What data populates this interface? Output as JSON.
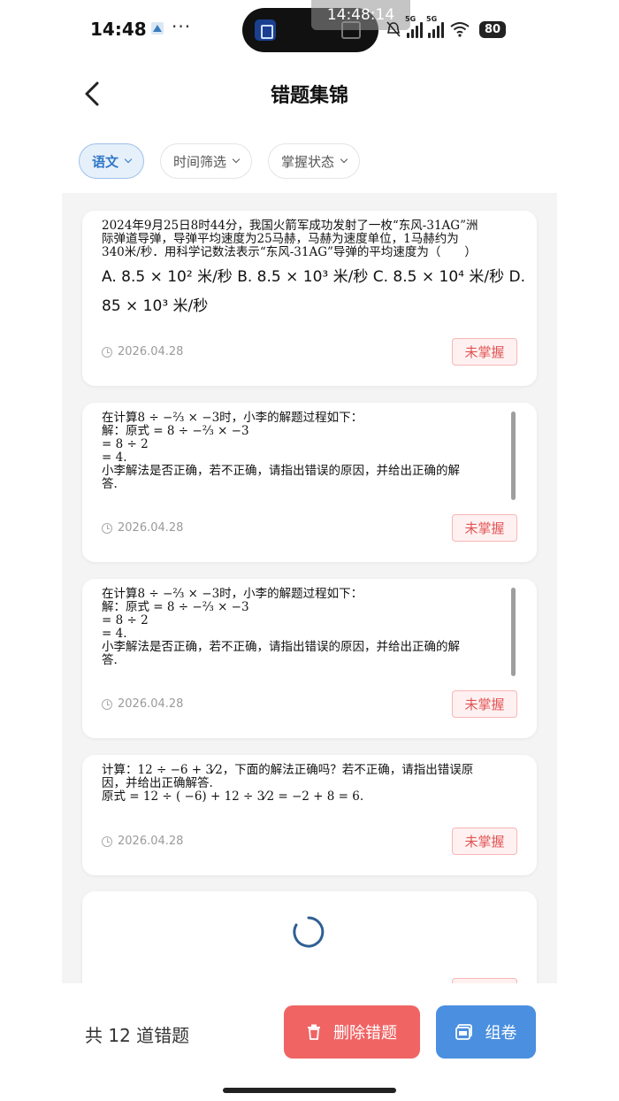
{
  "status_bar": {
    "time": "14:48",
    "dots": "···",
    "overlay_time": "14:48:14",
    "network_a": "5G",
    "network_b": "5G",
    "battery": "80"
  },
  "header": {
    "title": "错题集锦"
  },
  "filters": [
    {
      "label": "语文",
      "active": true
    },
    {
      "label": "时间筛选",
      "active": false
    },
    {
      "label": "掌握状态",
      "active": false
    }
  ],
  "cards": [
    {
      "lines": [
        "2024年9月25日8时44分，我国火箭军成功发射了一枚“东风-31AG”洲",
        "际弹道导弹，导弹平均速度为25马赫，马赫为速度单位，1马赫约为",
        "340米/秒．用科学记数法表示“东风-31AG”导弹的平均速度为（　　）"
      ],
      "options_line1": "A. 8.5 × 10² 米/秒  B. 8.5 × 10³ 米/秒  C. 8.5 × 10⁴ 米/秒  D.",
      "options_line2": "85 × 10³ 米/秒",
      "date": "2026.04.28",
      "status": "未掌握"
    },
    {
      "lines": [
        "在计算8 ÷ −⅔ × −3时，小李的解题过程如下：",
        "解：原式 = 8 ÷ −⅔ × −3",
        " = 8 ÷ 2",
        " = 4.",
        "小李解法是否正确，若不正确，请指出错误的原因，并给出正确的解",
        "答."
      ],
      "date": "2026.04.28",
      "status": "未掌握"
    },
    {
      "lines": [
        "在计算8 ÷ −⅔ × −3时，小李的解题过程如下：",
        "解：原式 = 8 ÷ −⅔ × −3",
        " = 8 ÷ 2",
        " = 4.",
        "小李解法是否正确，若不正确，请指出错误的原因，并给出正确的解",
        "答."
      ],
      "date": "2026.04.28",
      "status": "未掌握"
    },
    {
      "lines": [
        "计算：12 ÷ −6 + 3⁄2，下面的解法正确吗？若不正确，请指出错误原",
        "因，并给出正确解答.",
        "原式 = 12 ÷ ( −6) + 12 ÷ 3⁄2 = −2 + 8 = 6."
      ],
      "date": "2026.04.28",
      "status": "未掌握"
    }
  ],
  "footer": {
    "total": "共 12 道错题",
    "delete_label": "删除错题",
    "compose_label": "组卷"
  },
  "colors": {
    "accent": "#4a8fe0",
    "danger": "#f06464",
    "badge_text": "#e05353"
  }
}
